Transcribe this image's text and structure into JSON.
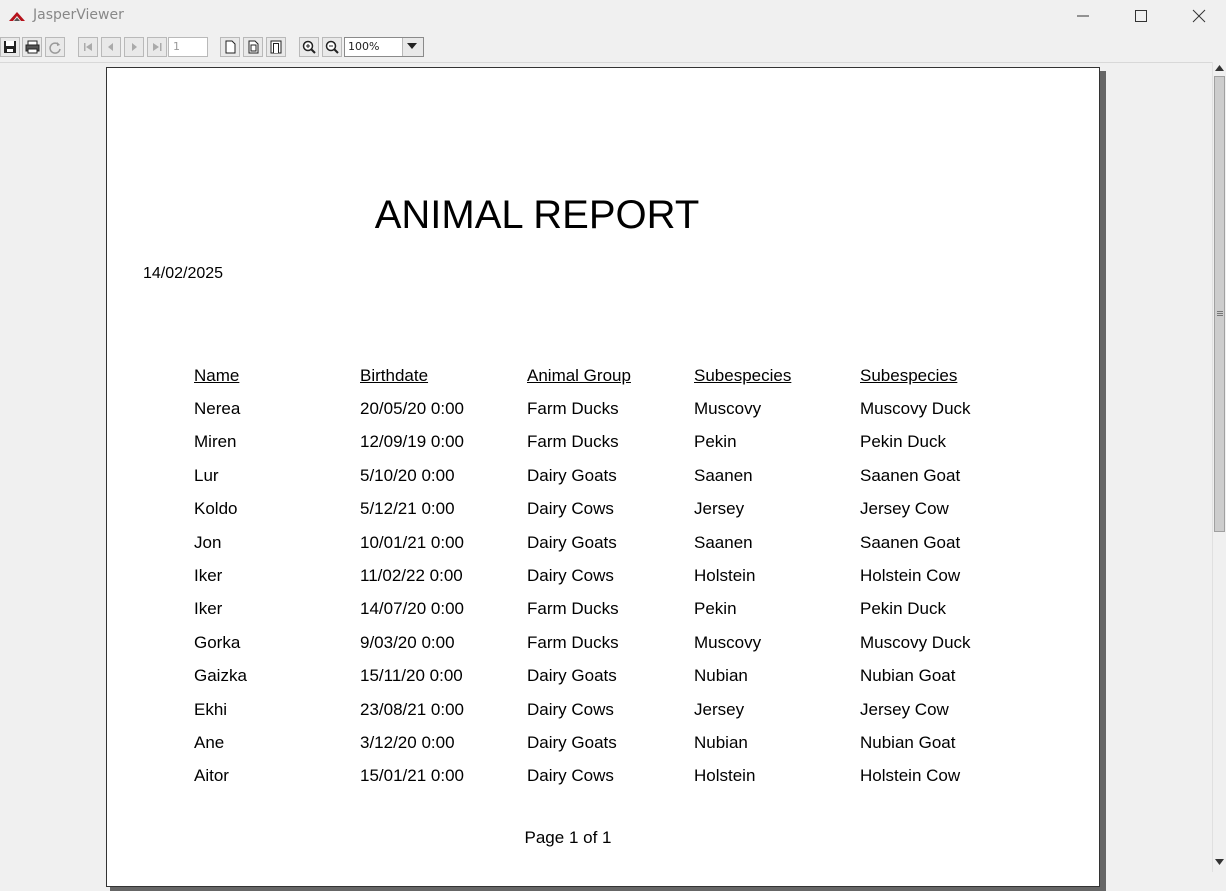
{
  "window": {
    "title": "JasperViewer",
    "icon": "jasper-logo-icon"
  },
  "toolbar": {
    "page_number": "1",
    "zoom": "100%",
    "icons": [
      "save-icon",
      "print-icon",
      "reload-icon",
      "first-page-icon",
      "previous-page-icon",
      "next-page-icon",
      "last-page-icon",
      "actual-size-icon",
      "fit-page-icon",
      "fit-width-icon",
      "zoom-in-icon",
      "zoom-out-icon",
      "chevron-down-icon"
    ]
  },
  "report": {
    "title": "ANIMAL REPORT",
    "date": "14/02/2025",
    "columns": [
      "Name",
      "Birthdate",
      "Animal Group",
      "Subespecies",
      "Subespecies"
    ],
    "rows": [
      [
        "Nerea",
        "20/05/20 0:00",
        "Farm Ducks",
        "Muscovy",
        "Muscovy Duck"
      ],
      [
        "Miren",
        "12/09/19 0:00",
        "Farm Ducks",
        "Pekin",
        "Pekin Duck"
      ],
      [
        "Lur",
        "5/10/20 0:00",
        "Dairy Goats",
        "Saanen",
        "Saanen Goat"
      ],
      [
        "Koldo",
        "5/12/21 0:00",
        "Dairy Cows",
        "Jersey",
        "Jersey Cow"
      ],
      [
        "Jon",
        "10/01/21 0:00",
        "Dairy Goats",
        "Saanen",
        "Saanen Goat"
      ],
      [
        "Iker",
        "11/02/22 0:00",
        "Dairy Cows",
        "Holstein",
        "Holstein Cow"
      ],
      [
        "Iker",
        "14/07/20 0:00",
        "Farm Ducks",
        "Pekin",
        "Pekin Duck"
      ],
      [
        "Gorka",
        "9/03/20 0:00",
        "Farm Ducks",
        "Muscovy",
        "Muscovy Duck"
      ],
      [
        "Gaizka",
        "15/11/20 0:00",
        "Dairy Goats",
        "Nubian",
        "Nubian Goat"
      ],
      [
        "Ekhi",
        "23/08/21 0:00",
        "Dairy Cows",
        "Jersey",
        "Jersey Cow"
      ],
      [
        "Ane",
        "3/12/20 0:00",
        "Dairy Goats",
        "Nubian",
        "Nubian Goat"
      ],
      [
        "Aitor",
        "15/01/21 0:00",
        "Dairy Cows",
        "Holstein",
        "Holstein Cow"
      ]
    ],
    "footer": "Page 1 of 1"
  },
  "colors": {
    "chrome": "#f0f0f0",
    "page": "#ffffff",
    "logo": "#b5121b"
  }
}
